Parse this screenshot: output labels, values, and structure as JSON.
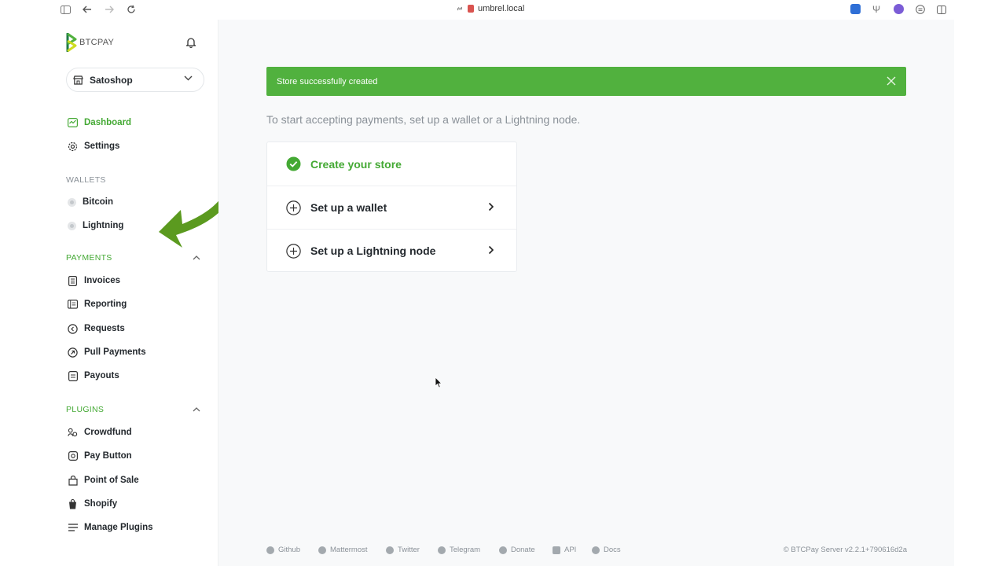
{
  "browser": {
    "url": "umbrel.local"
  },
  "sidebar": {
    "logo_text": "BTCPAY",
    "store": {
      "name": "Satoshop"
    },
    "nav": [
      {
        "label": "Dashboard",
        "icon": "dashboard-icon",
        "active": true
      },
      {
        "label": "Settings",
        "icon": "gear-icon",
        "active": false
      }
    ],
    "wallets": {
      "title": "WALLETS",
      "items": [
        {
          "label": "Bitcoin"
        },
        {
          "label": "Lightning"
        }
      ]
    },
    "payments": {
      "title": "PAYMENTS",
      "items": [
        {
          "label": "Invoices",
          "icon": "invoice-icon"
        },
        {
          "label": "Reporting",
          "icon": "reporting-icon"
        },
        {
          "label": "Requests",
          "icon": "requests-icon"
        },
        {
          "label": "Pull Payments",
          "icon": "pull-payments-icon"
        },
        {
          "label": "Payouts",
          "icon": "payouts-icon"
        }
      ]
    },
    "plugins": {
      "title": "PLUGINS",
      "items": [
        {
          "label": "Crowdfund",
          "icon": "crowdfund-icon"
        },
        {
          "label": "Pay Button",
          "icon": "pay-button-icon"
        },
        {
          "label": "Point of Sale",
          "icon": "point-of-sale-icon"
        },
        {
          "label": "Shopify",
          "icon": "shopify-icon"
        },
        {
          "label": "Manage Plugins",
          "icon": "manage-plugins-icon"
        }
      ]
    }
  },
  "main": {
    "alert": "Store successfully created",
    "intro": "To start accepting payments, set up a wallet or a Lightning node.",
    "steps": [
      {
        "label": "Create your store",
        "done": true
      },
      {
        "label": "Set up a wallet",
        "done": false
      },
      {
        "label": "Set up a Lightning node",
        "done": false
      }
    ]
  },
  "footer": {
    "links": [
      "Github",
      "Mattermost",
      "Twitter",
      "Telegram",
      "Donate",
      "API",
      "Docs"
    ],
    "copyright": "© BTCPay Server v2.2.1+790616d2a"
  },
  "colors": {
    "accent": "#44a934",
    "alert_bg": "#51b13e",
    "annotation_arrow": "#5b9a1f"
  }
}
